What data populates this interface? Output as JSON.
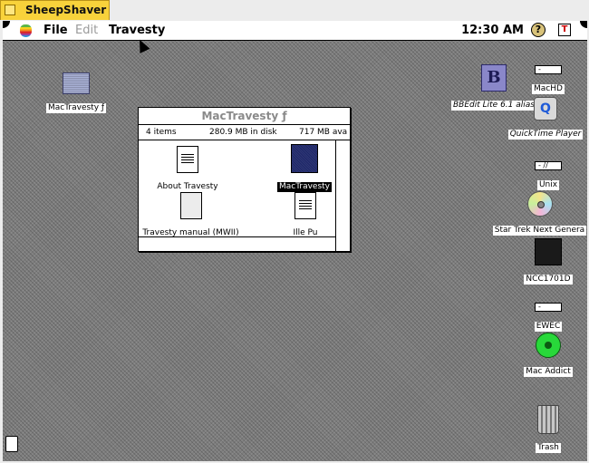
{
  "host": {
    "tab_title": "SheepShaver"
  },
  "menubar": {
    "items": [
      {
        "label": "File",
        "enabled": true
      },
      {
        "label": "Edit",
        "enabled": false
      },
      {
        "label": "Travesty",
        "enabled": true
      }
    ],
    "clock": "12:30 AM",
    "help_glyph": "?",
    "app_glyph": "T"
  },
  "desktop_icons": [
    {
      "label": "MacTravesty ƒ",
      "icon": "folder-icon",
      "italic": false
    },
    {
      "label": "BBEdit Lite 6.1 alias",
      "icon": "bbedit-icon",
      "italic": true
    },
    {
      "label": "MacHD",
      "icon": "hard-disk-icon",
      "italic": false
    },
    {
      "label": "QuickTime Player",
      "icon": "quicktime-icon",
      "italic": true
    },
    {
      "label": "Unix",
      "icon": "hard-disk-icon",
      "italic": false
    },
    {
      "label": "Star Trek Next Genera",
      "icon": "cd-icon",
      "italic": false
    },
    {
      "label": "NCC1701D",
      "icon": "starship-icon",
      "italic": false
    },
    {
      "label": "EWEC",
      "icon": "hard-disk-icon",
      "italic": false
    },
    {
      "label": "Mac Addict",
      "icon": "green-disc-icon",
      "italic": false
    },
    {
      "label": "Trash",
      "icon": "trash-icon",
      "italic": false
    }
  ],
  "finder_window": {
    "title": "MacTravesty ƒ",
    "item_count": "4 items",
    "disk_used": "280.9 MB in disk",
    "available": "717 MB ava",
    "files": [
      {
        "label": "About Travesty",
        "icon": "document-icon",
        "selected": false
      },
      {
        "label": "MacTravesty",
        "icon": "application-icon",
        "selected": true
      },
      {
        "label": "Travesty manual (MWII)",
        "icon": "blank-document-icon",
        "selected": false
      },
      {
        "label": "Ille Pu",
        "icon": "document-icon",
        "selected": false
      }
    ]
  }
}
